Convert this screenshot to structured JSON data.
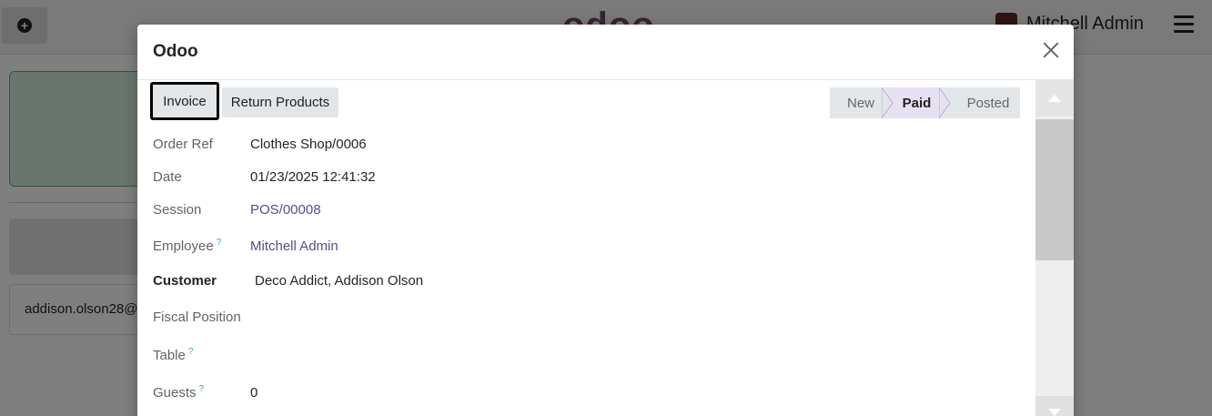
{
  "background": {
    "logo_text": "odoo",
    "user_name": "Mitchell Admin",
    "email_snippet": "addison.olson28@e"
  },
  "modal": {
    "title": "Odoo",
    "buttons": {
      "invoice": "Invoice",
      "return_products": "Return Products"
    },
    "statusbar": {
      "stages": [
        "New",
        "Paid",
        "Posted"
      ],
      "active": "Paid"
    },
    "fields": [
      {
        "label": "Order Ref",
        "value": "Clothes Shop/0006",
        "help": false,
        "link": false,
        "bold": false
      },
      {
        "label": "Date",
        "value": "01/23/2025 12:41:32",
        "help": false,
        "link": false,
        "bold": false
      },
      {
        "label": "Session",
        "value": "POS/00008",
        "help": false,
        "link": true,
        "bold": false
      },
      {
        "label": "Employee",
        "value": "Mitchell Admin",
        "help": true,
        "link": true,
        "bold": false
      },
      {
        "label": "Customer",
        "value": "Deco Addict, Addison Olson",
        "help": false,
        "link": false,
        "bold": true
      },
      {
        "label": "Fiscal Position",
        "value": "",
        "help": false,
        "link": false,
        "bold": false
      },
      {
        "label": "Table",
        "value": "",
        "help": true,
        "link": false,
        "bold": false
      },
      {
        "label": "Guests",
        "value": "0",
        "help": true,
        "link": false,
        "bold": false
      }
    ],
    "help_mark": "?"
  },
  "colors": {
    "brand": "#714b67",
    "link": "#5b4a8b",
    "help": "#3fa3c0",
    "active_stage": "#e7e0f0"
  }
}
